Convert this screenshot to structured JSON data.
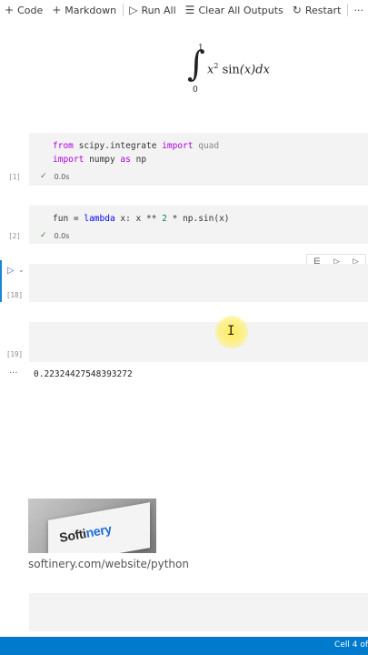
{
  "toolbar": {
    "code_label": "Code",
    "markdown_label": "Markdown",
    "run_all_label": "Run All",
    "clear_outputs_label": "Clear All Outputs",
    "restart_label": "Restart",
    "more_label": "···"
  },
  "markdown_cell": {
    "upper_limit": "1",
    "lower_limit": "0",
    "integrand_var": "x",
    "integrand_exp": "2",
    "integrand_fn": "sin",
    "integrand_arg": "(x)",
    "differential": "dx"
  },
  "cells": [
    {
      "exec_count": "[1]",
      "line1": {
        "kw1": "from",
        "mod": "scipy.integrate",
        "kw2": "import",
        "name": "quad"
      },
      "line2": {
        "kw1": "import",
        "mod": "numpy",
        "kw2": "as",
        "name": "np"
      },
      "status": "0.0s"
    },
    {
      "exec_count": "[2]",
      "line1": {
        "var": "fun",
        "op": " = ",
        "kw": "lambda",
        "rest1": " x: x ** ",
        "num": "2",
        "rest2": " * np.sin(x)"
      },
      "status": "0.0s"
    },
    {
      "exec_count": "[18]"
    },
    {
      "exec_count": "[19]"
    }
  ],
  "output": {
    "dots": "···",
    "value": "0.22324427548393272"
  },
  "logo": {
    "text_dark": "Softi",
    "text_blue": "nery"
  },
  "caption": "softinery.com/website/python",
  "statusbar": {
    "right_text": "Cell 4 of"
  },
  "colors": {
    "status_bar": "#007acc",
    "focus_bar": "#1a85d6",
    "cell_bg": "#f3f3f3",
    "keyword": "#af00db"
  }
}
